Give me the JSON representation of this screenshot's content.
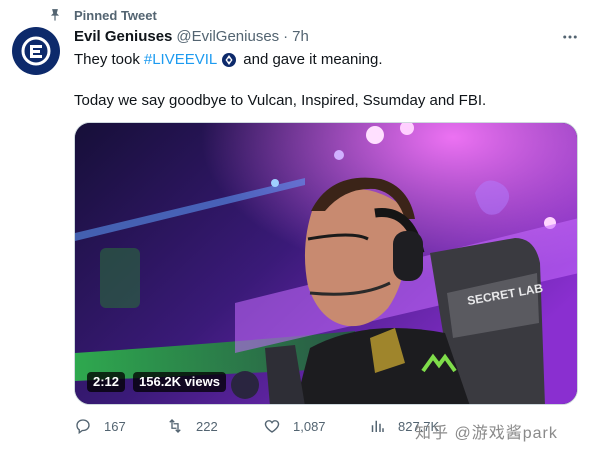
{
  "pinned": {
    "label": "Pinned Tweet"
  },
  "author": {
    "name": "Evil Geniuses",
    "handle": "@EvilGeniuses",
    "separator": "·",
    "time": "7h"
  },
  "tweet": {
    "line1_before": "They took",
    "hashtag": "#LIVEEVIL",
    "line1_after": "and gave it meaning.",
    "line2": "Today we say goodbye to Vulcan, Inspired, Ssumday and FBI."
  },
  "media": {
    "duration": "2:12",
    "views": "156.2K views",
    "chair_brand": "SECRET LAB"
  },
  "actions": {
    "replies": "167",
    "retweets": "222",
    "likes": "1,087",
    "analytics": "827.7K"
  },
  "watermark": "知乎 @游戏酱park",
  "colors": {
    "accent": "#1d9bf0",
    "muted": "#536471",
    "brand": "#0d2a6b"
  }
}
